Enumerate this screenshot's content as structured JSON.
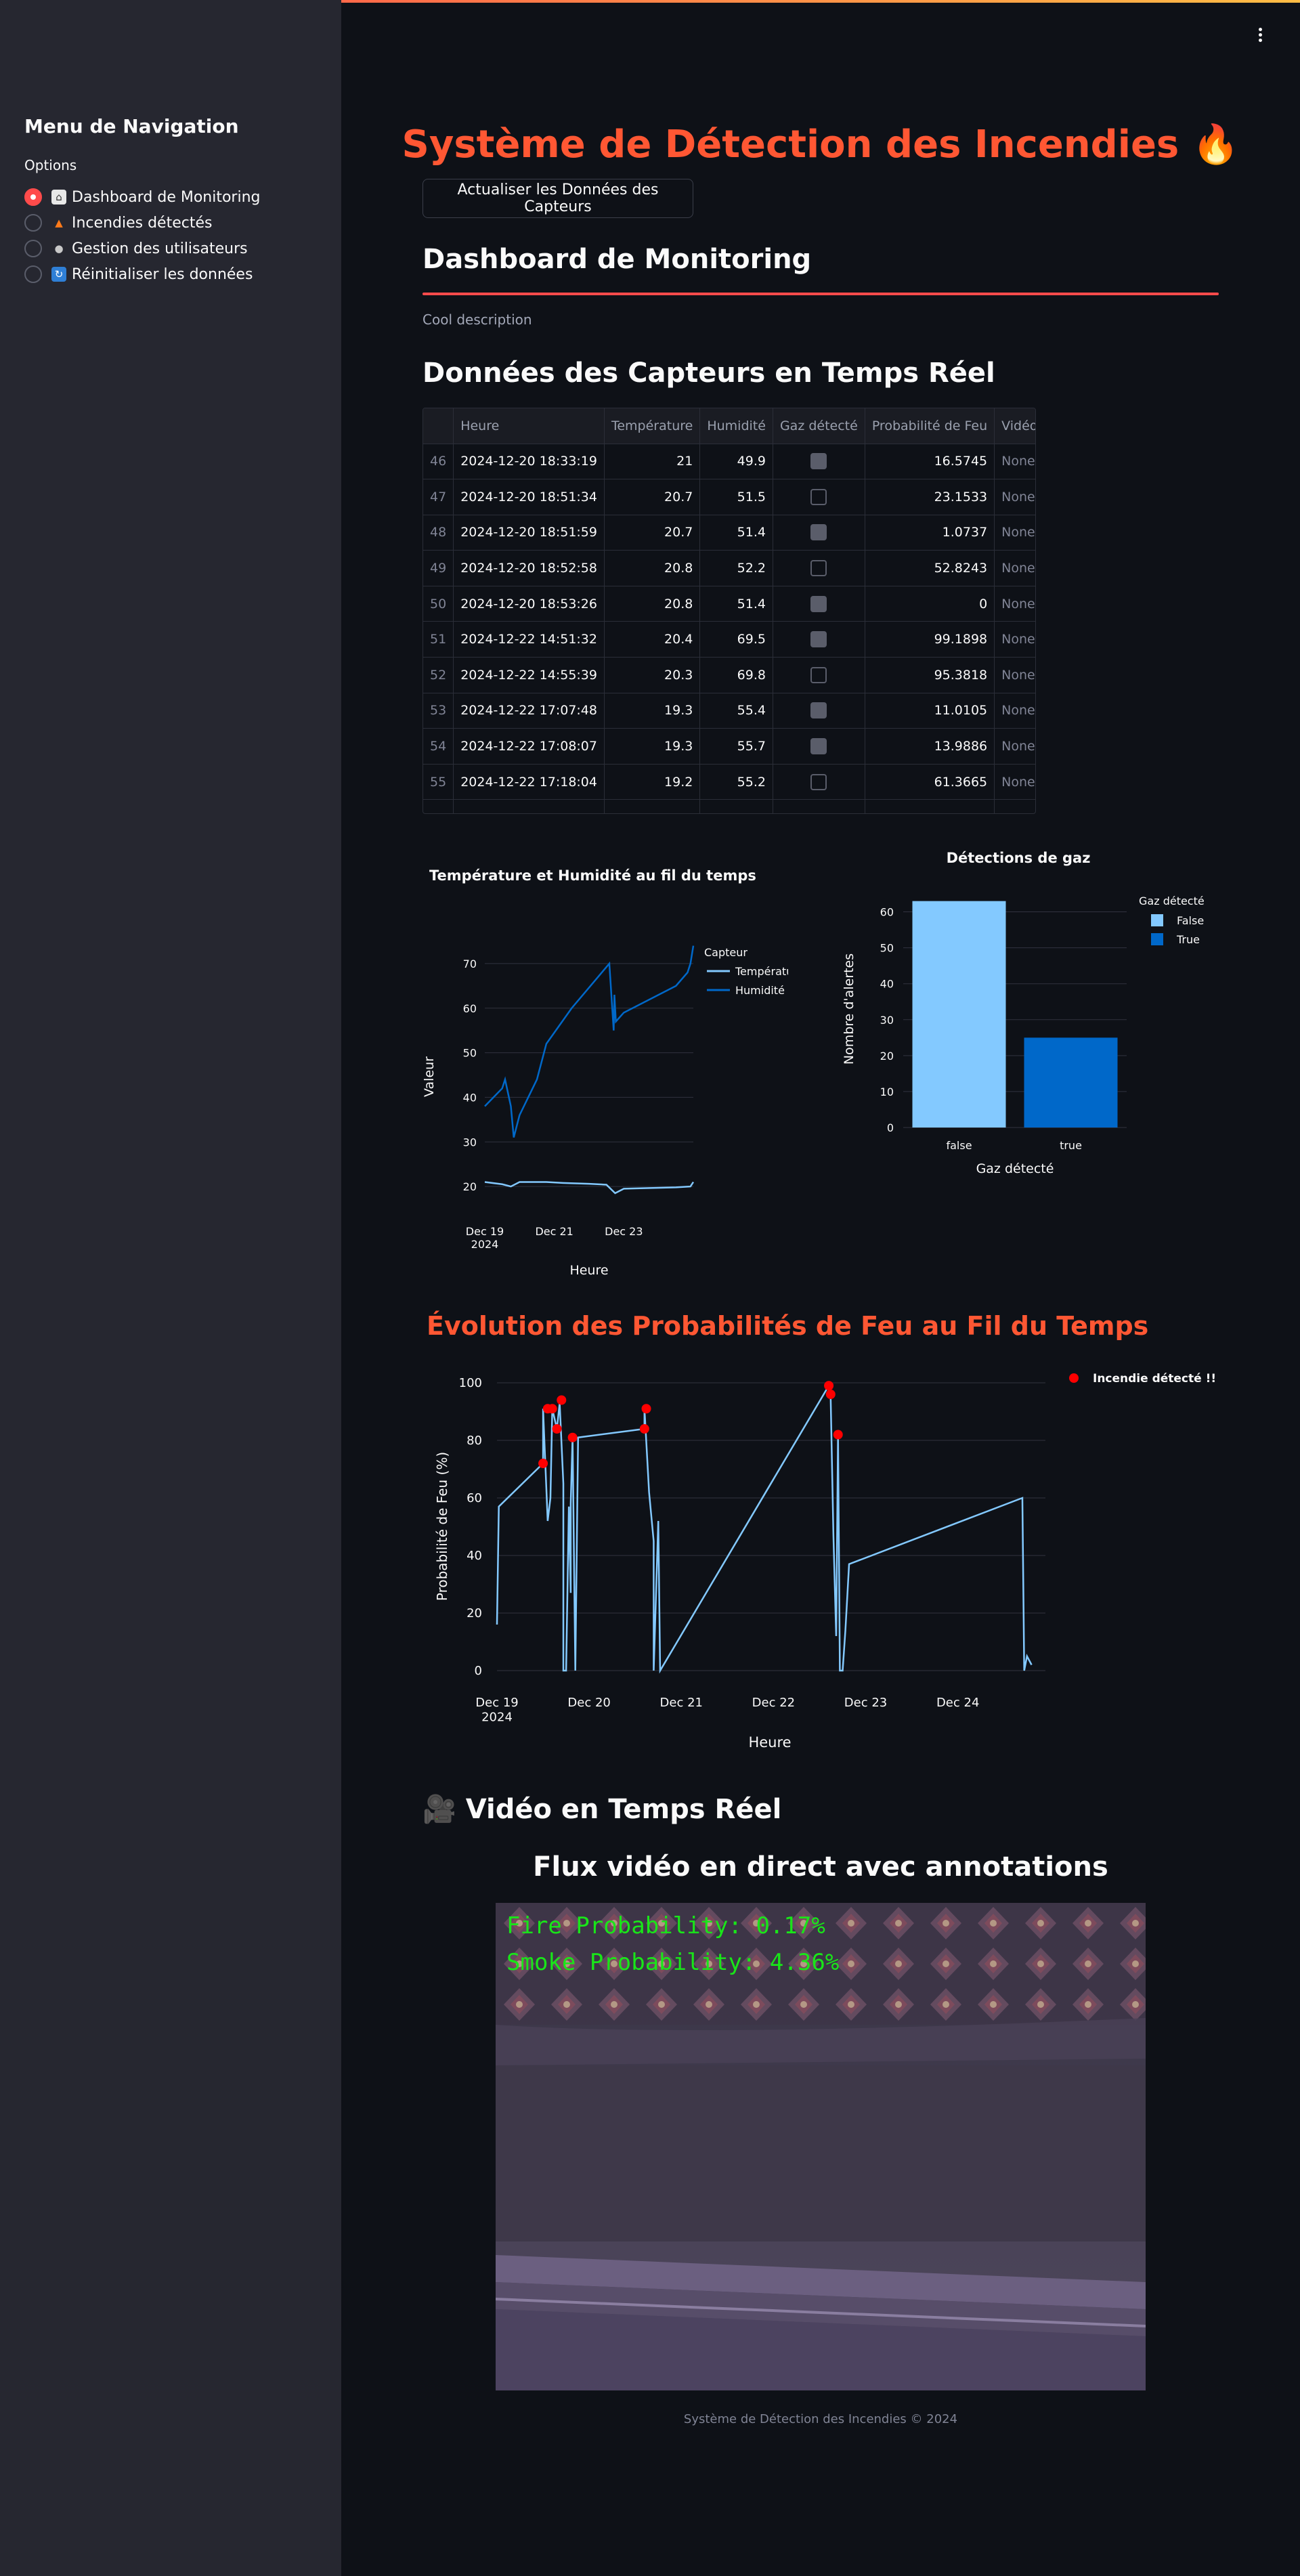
{
  "sidebar": {
    "title": "Menu de Navigation",
    "options_label": "Options",
    "items": [
      {
        "label": "Dashboard de Monitoring",
        "icon": "house-icon",
        "checked": true
      },
      {
        "label": "Incendies détectés",
        "icon": "fire-icon",
        "checked": false
      },
      {
        "label": "Gestion des utilisateurs",
        "icon": "users-icon",
        "checked": false
      },
      {
        "label": "Réinitialiser les données",
        "icon": "refresh-icon",
        "checked": false
      }
    ]
  },
  "header": {
    "title": "Système de Détection des Incendies 🔥",
    "refresh_button": "Actualiser les Données des Capteurs"
  },
  "dashboard": {
    "title": "Dashboard de Monitoring",
    "caption": "Cool description",
    "sensors_title": "Données des Capteurs en Temps Réel"
  },
  "table": {
    "columns": [
      "",
      "Heure",
      "Température",
      "Humidité",
      "Gaz détecté",
      "Probabilité de Feu",
      "Vidéo"
    ],
    "rows": [
      {
        "idx": "46",
        "heure": "2024-12-20 18:33:19",
        "temp": "21",
        "hum": "49.9",
        "gaz": true,
        "prob": "16.5745",
        "video": "None"
      },
      {
        "idx": "47",
        "heure": "2024-12-20 18:51:34",
        "temp": "20.7",
        "hum": "51.5",
        "gaz": false,
        "prob": "23.1533",
        "video": "None"
      },
      {
        "idx": "48",
        "heure": "2024-12-20 18:51:59",
        "temp": "20.7",
        "hum": "51.4",
        "gaz": true,
        "prob": "1.0737",
        "video": "None"
      },
      {
        "idx": "49",
        "heure": "2024-12-20 18:52:58",
        "temp": "20.8",
        "hum": "52.2",
        "gaz": false,
        "prob": "52.8243",
        "video": "None"
      },
      {
        "idx": "50",
        "heure": "2024-12-20 18:53:26",
        "temp": "20.8",
        "hum": "51.4",
        "gaz": true,
        "prob": "0",
        "video": "None"
      },
      {
        "idx": "51",
        "heure": "2024-12-22 14:51:32",
        "temp": "20.4",
        "hum": "69.5",
        "gaz": true,
        "prob": "99.1898",
        "video": "None"
      },
      {
        "idx": "52",
        "heure": "2024-12-22 14:55:39",
        "temp": "20.3",
        "hum": "69.8",
        "gaz": false,
        "prob": "95.3818",
        "video": "None"
      },
      {
        "idx": "53",
        "heure": "2024-12-22 17:07:48",
        "temp": "19.3",
        "hum": "55.4",
        "gaz": true,
        "prob": "11.0105",
        "video": "None"
      },
      {
        "idx": "54",
        "heure": "2024-12-22 17:08:07",
        "temp": "19.3",
        "hum": "55.7",
        "gaz": true,
        "prob": "13.9886",
        "video": "None"
      },
      {
        "idx": "55",
        "heure": "2024-12-22 17:18:04",
        "temp": "19.2",
        "hum": "55.2",
        "gaz": false,
        "prob": "61.3665",
        "video": "None"
      }
    ]
  },
  "chart_data": [
    {
      "type": "line",
      "title": "Température et Humidité au fil du temps",
      "xlabel": "Heure",
      "ylabel": "Valeur",
      "x_ticks": [
        "Dec 19\n2024",
        "Dec 21",
        "Dec 23"
      ],
      "y_ticks": [
        20,
        30,
        40,
        50,
        60,
        70
      ],
      "ylim": [
        15,
        75
      ],
      "legend_title": "Capteur",
      "legend_position": "top-right",
      "colors": {
        "Température": "#83c9ff",
        "Humidité": "#0068c9"
      },
      "series": [
        {
          "name": "Température",
          "x": [
            "2024-12-19 00:00",
            "2024-12-19 12:00",
            "2024-12-19 18:00",
            "2024-12-20 00:00",
            "2024-12-20 12:00",
            "2024-12-20 18:30",
            "2024-12-21 06:00",
            "2024-12-22 00:00",
            "2024-12-22 12:00",
            "2024-12-22 18:00",
            "2024-12-23 00:00",
            "2024-12-24 12:00",
            "2024-12-24 22:00",
            "2024-12-25 00:00"
          ],
          "values": [
            21,
            20.5,
            20,
            21,
            21,
            21,
            20.8,
            20.6,
            20.4,
            18.5,
            19.5,
            19.8,
            20,
            21
          ]
        },
        {
          "name": "Humidité",
          "x": [
            "2024-12-19 00:00",
            "2024-12-19 12:00",
            "2024-12-19 14:00",
            "2024-12-19 18:00",
            "2024-12-19 20:00",
            "2024-12-20 00:00",
            "2024-12-20 12:00",
            "2024-12-20 18:30",
            "2024-12-21 12:00",
            "2024-12-22 14:00",
            "2024-12-22 17:00",
            "2024-12-22 17:30",
            "2024-12-22 18:30",
            "2024-12-23 00:00",
            "2024-12-24 12:00",
            "2024-12-24 20:00",
            "2024-12-24 22:00",
            "2024-12-25 00:00"
          ],
          "values": [
            38,
            42,
            44,
            38,
            31,
            36,
            44,
            52,
            60,
            70,
            55,
            63,
            57,
            59,
            65,
            68,
            70,
            74
          ]
        }
      ]
    },
    {
      "type": "bar",
      "title": "Détections de gaz",
      "xlabel": "Gaz détecté",
      "ylabel": "Nombre d'alertes",
      "categories": [
        "false",
        "true"
      ],
      "values": [
        63,
        25
      ],
      "ylim": [
        0,
        65
      ],
      "y_ticks": [
        0,
        10,
        20,
        30,
        40,
        50,
        60
      ],
      "legend_title": "Gaz détecté",
      "legend_position": "top-right",
      "series": [
        {
          "name": "False",
          "color": "#83c9ff"
        },
        {
          "name": "True",
          "color": "#0068c9"
        }
      ]
    },
    {
      "type": "line",
      "title": "Évolution des Probabilités de Feu au Fil du Temps",
      "xlabel": "Heure",
      "ylabel": "Probabilité de Feu (%)",
      "x_ticks": [
        "Dec 19\n2024",
        "Dec 20",
        "Dec 21",
        "Dec 22",
        "Dec 23",
        "Dec 24"
      ],
      "y_ticks": [
        0,
        20,
        40,
        60,
        80,
        100
      ],
      "ylim": [
        0,
        100
      ],
      "legend_position": "top-right",
      "line_color": "#83c9ff",
      "marker_color": "#ff0000",
      "series": [
        {
          "name": "Probabilité de Feu",
          "x": [
            0,
            0.02,
            0.5,
            0.5,
            0.55,
            0.58,
            0.6,
            0.65,
            0.68,
            0.72,
            0.72,
            0.75,
            0.78,
            0.8,
            0.8,
            0.82,
            0.85,
            0.85,
            0.88,
            1.6,
            1.6,
            1.65,
            1.7,
            1.7,
            1.75,
            1.77,
            3.6,
            3.62,
            3.65,
            3.68,
            3.7,
            3.72,
            3.75,
            3.78,
            3.82,
            5.7,
            5.72,
            5.75,
            5.8
          ],
          "values": [
            16,
            57,
            72,
            91,
            52,
            60,
            91,
            84,
            93,
            65,
            0,
            0,
            57,
            27,
            58,
            81,
            0,
            0,
            81,
            84,
            91,
            62,
            45,
            0,
            52,
            0,
            99,
            95,
            47,
            12,
            82,
            0,
            0,
            14,
            37,
            60,
            0,
            5,
            2
          ]
        }
      ],
      "detected": {
        "name": "Incendie détecté !!",
        "x": [
          0.5,
          0.55,
          0.6,
          0.65,
          0.7,
          0.82,
          1.6,
          1.62,
          3.6,
          3.62,
          3.7
        ],
        "values": [
          72,
          91,
          91,
          84,
          94,
          81,
          84,
          91,
          99,
          96,
          82
        ]
      }
    }
  ],
  "video": {
    "title": "🎥 Vidéo en Temps Réel",
    "subtitle": "Flux vidéo en direct avec annotations",
    "fire_text": "Fire Probability: 0.17%",
    "smoke_text": "Smoke Probability: 4.36%"
  },
  "footer": "Système de Détection des Incendies © 2024"
}
